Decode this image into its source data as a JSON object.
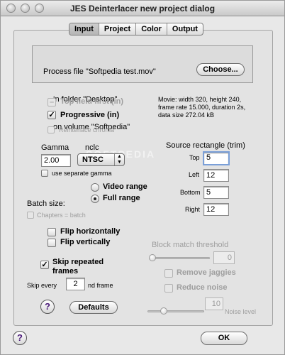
{
  "window": {
    "title": "JES Deinterlacer new project dialog"
  },
  "tabs": [
    {
      "label": "Input",
      "selected": true
    },
    {
      "label": "Project",
      "selected": false
    },
    {
      "label": "Color",
      "selected": false
    },
    {
      "label": "Output",
      "selected": false
    }
  ],
  "file": {
    "line1": "Process file \"Softpedia test.mov\"",
    "line2": "in folder \"Desktop\"",
    "line3": "on volume \"Softpedia\"",
    "choose_label": "Choose..."
  },
  "movie_info": {
    "line1": "Movie: width 320, height 240,",
    "line2": "frame rate 15.000, duration 2s,",
    "line3": "data size 272.04 kB"
  },
  "field": {
    "top_field_first": "Top field first (in)",
    "progressive": "Progressive (in)",
    "reinterlace_chroma": "Reinterlace chroma"
  },
  "gamma": {
    "label": "Gamma",
    "value": "2.00",
    "nclc_label": "nclc",
    "nclc_value": "NTSC",
    "use_separate": "use separate gamma"
  },
  "range": {
    "video": "Video range",
    "full": "Full range",
    "selected": "full"
  },
  "source_rect": {
    "title": "Source rectangle (trim)",
    "top_label": "Top",
    "top": "5",
    "left_label": "Left",
    "left": "12",
    "bottom_label": "Bottom",
    "bottom": "5",
    "right_label": "Right",
    "right": "12"
  },
  "batch": {
    "label": "Batch size:",
    "chapters": "Chapters = batch"
  },
  "flip": {
    "horizontal": "Flip horizontally",
    "vertical": "Flip vertically"
  },
  "skip": {
    "label_line1": "Skip repeated",
    "label_line2": "frames",
    "every_label": "Skip every",
    "every_value": "2",
    "suffix": "nd frame"
  },
  "block_match": {
    "label": "Block match threshold",
    "value": "0",
    "remove_jaggies": "Remove jaggies",
    "reduce_noise": "Reduce noise",
    "noise_value": "10",
    "noise_label": "Noise level"
  },
  "buttons": {
    "help": "?",
    "defaults": "Defaults",
    "ok": "OK"
  },
  "watermark": "SOFTPEDIA"
}
